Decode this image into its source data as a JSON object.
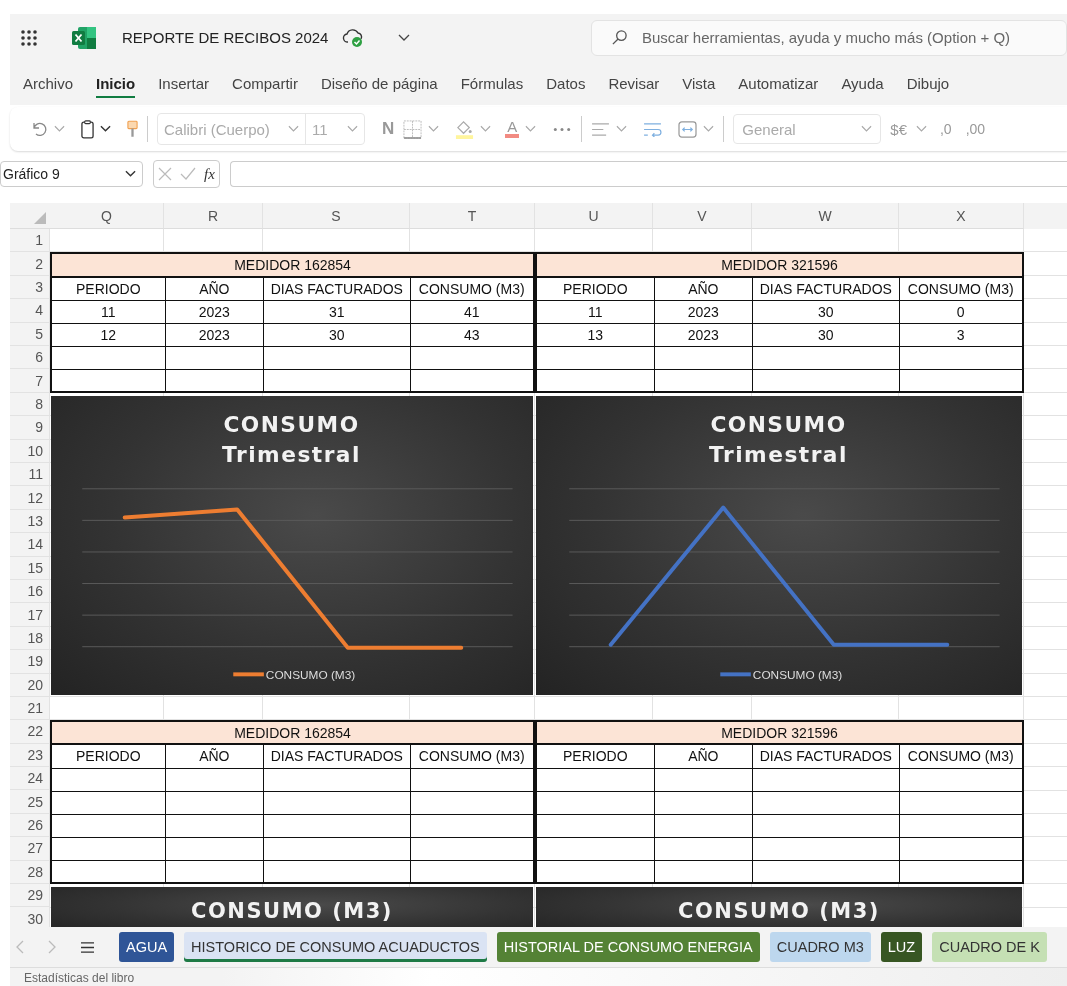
{
  "document": {
    "title": "REPORTE DE RECIBOS 2024",
    "synced": true
  },
  "search": {
    "placeholder": "Buscar herramientas, ayuda y mucho más (Option + Q)"
  },
  "menu_tabs": [
    {
      "label": "Archivo",
      "selected": false
    },
    {
      "label": "Inicio",
      "selected": true
    },
    {
      "label": "Insertar",
      "selected": false
    },
    {
      "label": "Compartir",
      "selected": false
    },
    {
      "label": "Diseño de página",
      "selected": false
    },
    {
      "label": "Fórmulas",
      "selected": false
    },
    {
      "label": "Datos",
      "selected": false
    },
    {
      "label": "Revisar",
      "selected": false
    },
    {
      "label": "Vista",
      "selected": false
    },
    {
      "label": "Automatizar",
      "selected": false
    },
    {
      "label": "Ayuda",
      "selected": false
    },
    {
      "label": "Dibujo",
      "selected": false
    }
  ],
  "toolbar": {
    "font": "Calibri (Cuerpo)",
    "size": "11",
    "bold": "N",
    "font_color": "A",
    "number_format": "General",
    "currency": "$€",
    "decrease_decimals": ",0",
    "increase_decimals": ",00"
  },
  "formula_bar": {
    "name_box": "Gráfico 9",
    "function": "fx"
  },
  "sheet": {
    "columns": [
      "Q",
      "R",
      "S",
      "T",
      "U",
      "V",
      "W",
      "X"
    ],
    "row_numbers": [
      "1",
      "2",
      "3",
      "4",
      "5",
      "6",
      "7",
      "8",
      "9",
      "10",
      "11",
      "12",
      "13",
      "14",
      "15",
      "16",
      "17",
      "18",
      "19",
      "20",
      "21",
      "22",
      "23",
      "24",
      "25",
      "26",
      "27",
      "28",
      "29",
      "30"
    ],
    "blocks": [
      {
        "meters": [
          {
            "title": "MEDIDOR 162854",
            "headers": [
              "PERIODO",
              "AÑO",
              "DIAS FACTURADOS",
              "CONSUMO (M3)"
            ],
            "rows": [
              [
                "11",
                "2023",
                "31",
                "41"
              ],
              [
                "12",
                "2023",
                "30",
                "43"
              ]
            ]
          },
          {
            "title": "MEDIDOR 321596",
            "headers": [
              "PERIODO",
              "AÑO",
              "DIAS FACTURADOS",
              "CONSUMO (M3)"
            ],
            "rows": [
              [
                "11",
                "2023",
                "30",
                "0"
              ],
              [
                "13",
                "2023",
                "30",
                "3"
              ]
            ]
          }
        ]
      },
      {
        "meters": [
          {
            "title": "MEDIDOR 162854",
            "headers": [
              "PERIODO",
              "AÑO",
              "DIAS FACTURADOS",
              "CONSUMO (M3)"
            ]
          },
          {
            "title": "MEDIDOR 321596",
            "headers": [
              "PERIODO",
              "AÑO",
              "DIAS FACTURADOS",
              "CONSUMO (M3)"
            ]
          }
        ]
      }
    ],
    "charts": [
      {
        "title": [
          "CONSUMO",
          "Trimestral"
        ],
        "legend": "CONSUMO (M3)",
        "color": "#ed7d31",
        "kind": "falling"
      },
      {
        "title": [
          "CONSUMO",
          "Trimestral"
        ],
        "legend": "CONSUMO (M3)",
        "color": "#4472c4",
        "kind": "peak"
      }
    ],
    "bottom_charts": [
      {
        "title": "CONSUMO (M3)"
      },
      {
        "title": "CONSUMO (M3)"
      }
    ]
  },
  "sheet_tabs": [
    {
      "label": "AGUA",
      "color": "#2f5597",
      "selected": false
    },
    {
      "label": "HISTORICO DE CONSUMO ACUADUCTOS",
      "color": "#dae3f3",
      "selected": true
    },
    {
      "label": "HISTORIAL DE CONSUMO ENERGIA",
      "color": "#548235",
      "selected": false
    },
    {
      "label": "CUADRO M3",
      "color": "#bdd7ee",
      "selected": false
    },
    {
      "label": "LUZ",
      "color": "#375623",
      "selected": false
    },
    {
      "label": "CUADRO DE K",
      "color": "#c5e0b4",
      "selected": false
    }
  ],
  "status_bar": {
    "text": "Estadísticas del libro"
  }
}
